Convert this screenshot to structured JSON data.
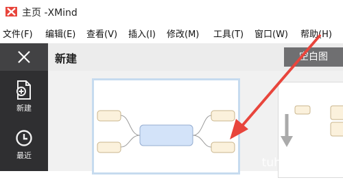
{
  "window": {
    "title": "主页 -XMind",
    "logo_icon": "xmind-logo-icon",
    "logo_color": "#e8453c"
  },
  "menu": [
    {
      "label": "文件(F)"
    },
    {
      "label": "编辑(E)"
    },
    {
      "label": "查看(V)"
    },
    {
      "label": "插入(I)"
    },
    {
      "label": "修改(M)"
    },
    {
      "label": "工具(T)"
    },
    {
      "label": "窗口(W)"
    },
    {
      "label": "帮助(H)"
    }
  ],
  "sidebar": {
    "close_icon": "close-icon",
    "items": [
      {
        "label": "新建",
        "icon": "new-file-icon"
      },
      {
        "label": "最近",
        "icon": "clock-icon"
      }
    ]
  },
  "header": {
    "title": "新建",
    "blank_button": "空白图"
  },
  "templates": [
    {
      "name": "mind-map-template",
      "selected": true
    },
    {
      "name": "logic-chart-template",
      "selected": false
    }
  ],
  "annotation": {
    "icon": "red-arrow-icon",
    "color": "#e8453c"
  },
  "watermark": "tuhuaba.com"
}
